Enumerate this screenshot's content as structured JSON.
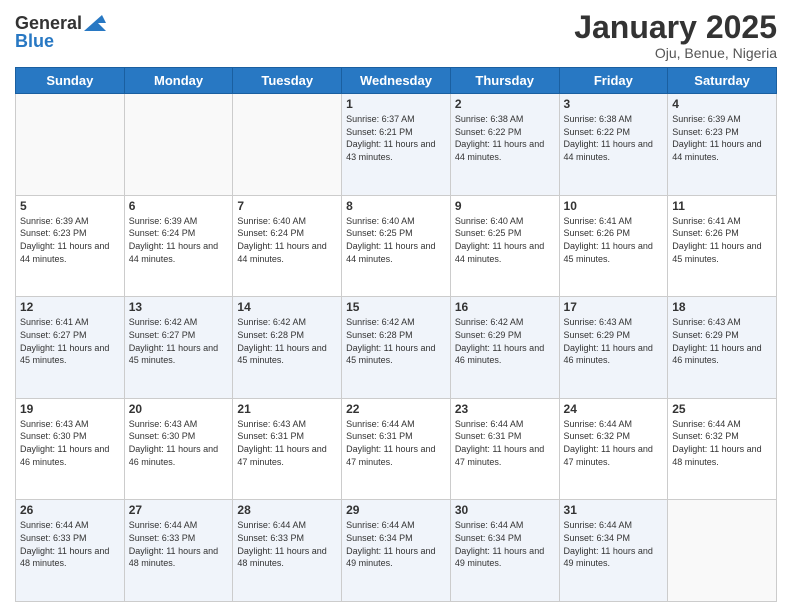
{
  "header": {
    "logo_line1": "General",
    "logo_line2": "Blue",
    "month_title": "January 2025",
    "location": "Oju, Benue, Nigeria"
  },
  "days_of_week": [
    "Sunday",
    "Monday",
    "Tuesday",
    "Wednesday",
    "Thursday",
    "Friday",
    "Saturday"
  ],
  "weeks": [
    [
      {
        "day": "",
        "sunrise": "",
        "sunset": "",
        "daylight": ""
      },
      {
        "day": "",
        "sunrise": "",
        "sunset": "",
        "daylight": ""
      },
      {
        "day": "",
        "sunrise": "",
        "sunset": "",
        "daylight": ""
      },
      {
        "day": "1",
        "sunrise": "6:37 AM",
        "sunset": "6:21 PM",
        "daylight": "11 hours and 43 minutes."
      },
      {
        "day": "2",
        "sunrise": "6:38 AM",
        "sunset": "6:22 PM",
        "daylight": "11 hours and 44 minutes."
      },
      {
        "day": "3",
        "sunrise": "6:38 AM",
        "sunset": "6:22 PM",
        "daylight": "11 hours and 44 minutes."
      },
      {
        "day": "4",
        "sunrise": "6:39 AM",
        "sunset": "6:23 PM",
        "daylight": "11 hours and 44 minutes."
      }
    ],
    [
      {
        "day": "5",
        "sunrise": "6:39 AM",
        "sunset": "6:23 PM",
        "daylight": "11 hours and 44 minutes."
      },
      {
        "day": "6",
        "sunrise": "6:39 AM",
        "sunset": "6:24 PM",
        "daylight": "11 hours and 44 minutes."
      },
      {
        "day": "7",
        "sunrise": "6:40 AM",
        "sunset": "6:24 PM",
        "daylight": "11 hours and 44 minutes."
      },
      {
        "day": "8",
        "sunrise": "6:40 AM",
        "sunset": "6:25 PM",
        "daylight": "11 hours and 44 minutes."
      },
      {
        "day": "9",
        "sunrise": "6:40 AM",
        "sunset": "6:25 PM",
        "daylight": "11 hours and 44 minutes."
      },
      {
        "day": "10",
        "sunrise": "6:41 AM",
        "sunset": "6:26 PM",
        "daylight": "11 hours and 45 minutes."
      },
      {
        "day": "11",
        "sunrise": "6:41 AM",
        "sunset": "6:26 PM",
        "daylight": "11 hours and 45 minutes."
      }
    ],
    [
      {
        "day": "12",
        "sunrise": "6:41 AM",
        "sunset": "6:27 PM",
        "daylight": "11 hours and 45 minutes."
      },
      {
        "day": "13",
        "sunrise": "6:42 AM",
        "sunset": "6:27 PM",
        "daylight": "11 hours and 45 minutes."
      },
      {
        "day": "14",
        "sunrise": "6:42 AM",
        "sunset": "6:28 PM",
        "daylight": "11 hours and 45 minutes."
      },
      {
        "day": "15",
        "sunrise": "6:42 AM",
        "sunset": "6:28 PM",
        "daylight": "11 hours and 45 minutes."
      },
      {
        "day": "16",
        "sunrise": "6:42 AM",
        "sunset": "6:29 PM",
        "daylight": "11 hours and 46 minutes."
      },
      {
        "day": "17",
        "sunrise": "6:43 AM",
        "sunset": "6:29 PM",
        "daylight": "11 hours and 46 minutes."
      },
      {
        "day": "18",
        "sunrise": "6:43 AM",
        "sunset": "6:29 PM",
        "daylight": "11 hours and 46 minutes."
      }
    ],
    [
      {
        "day": "19",
        "sunrise": "6:43 AM",
        "sunset": "6:30 PM",
        "daylight": "11 hours and 46 minutes."
      },
      {
        "day": "20",
        "sunrise": "6:43 AM",
        "sunset": "6:30 PM",
        "daylight": "11 hours and 46 minutes."
      },
      {
        "day": "21",
        "sunrise": "6:43 AM",
        "sunset": "6:31 PM",
        "daylight": "11 hours and 47 minutes."
      },
      {
        "day": "22",
        "sunrise": "6:44 AM",
        "sunset": "6:31 PM",
        "daylight": "11 hours and 47 minutes."
      },
      {
        "day": "23",
        "sunrise": "6:44 AM",
        "sunset": "6:31 PM",
        "daylight": "11 hours and 47 minutes."
      },
      {
        "day": "24",
        "sunrise": "6:44 AM",
        "sunset": "6:32 PM",
        "daylight": "11 hours and 47 minutes."
      },
      {
        "day": "25",
        "sunrise": "6:44 AM",
        "sunset": "6:32 PM",
        "daylight": "11 hours and 48 minutes."
      }
    ],
    [
      {
        "day": "26",
        "sunrise": "6:44 AM",
        "sunset": "6:33 PM",
        "daylight": "11 hours and 48 minutes."
      },
      {
        "day": "27",
        "sunrise": "6:44 AM",
        "sunset": "6:33 PM",
        "daylight": "11 hours and 48 minutes."
      },
      {
        "day": "28",
        "sunrise": "6:44 AM",
        "sunset": "6:33 PM",
        "daylight": "11 hours and 48 minutes."
      },
      {
        "day": "29",
        "sunrise": "6:44 AM",
        "sunset": "6:34 PM",
        "daylight": "11 hours and 49 minutes."
      },
      {
        "day": "30",
        "sunrise": "6:44 AM",
        "sunset": "6:34 PM",
        "daylight": "11 hours and 49 minutes."
      },
      {
        "day": "31",
        "sunrise": "6:44 AM",
        "sunset": "6:34 PM",
        "daylight": "11 hours and 49 minutes."
      },
      {
        "day": "",
        "sunrise": "",
        "sunset": "",
        "daylight": ""
      }
    ]
  ],
  "labels": {
    "sunrise": "Sunrise:",
    "sunset": "Sunset:",
    "daylight": "Daylight:"
  }
}
